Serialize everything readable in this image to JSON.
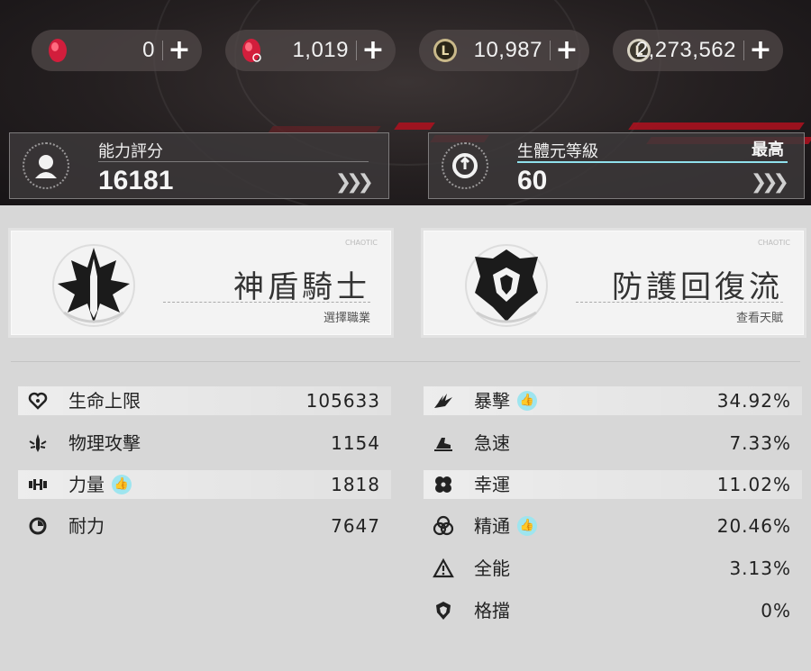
{
  "currencies": [
    {
      "icon": "red-gem-icon",
      "value": "0"
    },
    {
      "icon": "red-gem-bound-icon",
      "value": "1,019"
    },
    {
      "icon": "gold-coin-icon",
      "value": "10,987"
    },
    {
      "icon": "silver-coin-icon",
      "value": "2,273,562"
    }
  ],
  "ability_score": {
    "label": "能力評分",
    "value": "16181"
  },
  "bio_level": {
    "label": "生體元等級",
    "value": "60",
    "tag": "最高"
  },
  "class_card": {
    "title": "神盾騎士",
    "action": "選擇職業",
    "watermark": "CHAOTIC"
  },
  "talent_card": {
    "title": "防護回復流",
    "action": "查看天賦",
    "watermark": "CHAOTIC"
  },
  "stats_left": [
    {
      "icon": "heart-icon",
      "label": "生命上限",
      "value": "105633",
      "recommended": false
    },
    {
      "icon": "sword-attack-icon",
      "label": "物理攻擊",
      "value": "1154",
      "recommended": false
    },
    {
      "icon": "dumbbell-icon",
      "label": "力量",
      "value": "1818",
      "recommended": true
    },
    {
      "icon": "stamina-icon",
      "label": "耐力",
      "value": "7647",
      "recommended": false
    }
  ],
  "stats_right": [
    {
      "icon": "critical-icon",
      "label": "暴擊",
      "value": "34.92%",
      "recommended": true
    },
    {
      "icon": "haste-icon",
      "label": "急速",
      "value": "7.33%",
      "recommended": false
    },
    {
      "icon": "luck-clover-icon",
      "label": "幸運",
      "value": "11.02%",
      "recommended": false
    },
    {
      "icon": "mastery-icon",
      "label": "精通",
      "value": "20.46%",
      "recommended": true
    },
    {
      "icon": "versatility-icon",
      "label": "全能",
      "value": "3.13%",
      "recommended": false
    },
    {
      "icon": "block-shield-icon",
      "label": "格擋",
      "value": "0%",
      "recommended": false
    }
  ]
}
